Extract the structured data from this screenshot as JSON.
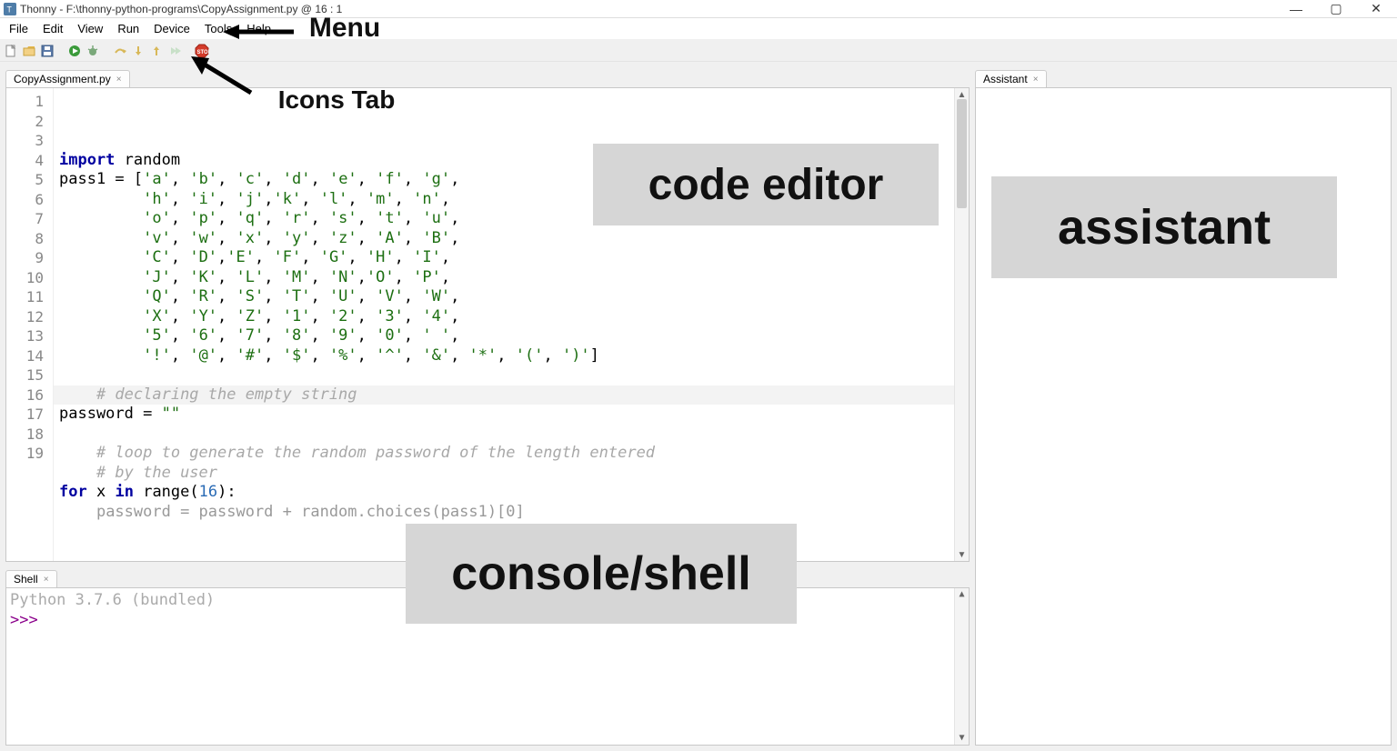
{
  "window": {
    "title": "Thonny  -  F:\\thonny-python-programs\\CopyAssignment.py  @  16 : 1",
    "buttons": {
      "min": "—",
      "max": "▢",
      "close": "✕"
    }
  },
  "menus": [
    "File",
    "Edit",
    "View",
    "Run",
    "Device",
    "Tools",
    "Help"
  ],
  "toolbar_icons": [
    "new-file-icon",
    "open-file-icon",
    "save-file-icon",
    "sep",
    "run-icon",
    "debug-icon",
    "sep",
    "step-over-icon",
    "step-into-icon",
    "step-out-icon",
    "resume-icon",
    "sep",
    "stop-icon"
  ],
  "editor": {
    "tab_label": "CopyAssignment.py",
    "line_count": 19,
    "current_line": 16,
    "code_lines": [
      {
        "n": 1,
        "html": "<span class='tok-kw'>import</span> <span class='tok-def'>random</span>"
      },
      {
        "n": 2,
        "html": "<span class='tok-def'>pass1</span> = [<span class='tok-str'>'a'</span>, <span class='tok-str'>'b'</span>, <span class='tok-str'>'c'</span>, <span class='tok-str'>'d'</span>, <span class='tok-str'>'e'</span>, <span class='tok-str'>'f'</span>, <span class='tok-str'>'g'</span>,"
      },
      {
        "n": 3,
        "html": "         <span class='tok-str'>'h'</span>, <span class='tok-str'>'i'</span>, <span class='tok-str'>'j'</span>,<span class='tok-str'>'k'</span>, <span class='tok-str'>'l'</span>, <span class='tok-str'>'m'</span>, <span class='tok-str'>'n'</span>,"
      },
      {
        "n": 4,
        "html": "         <span class='tok-str'>'o'</span>, <span class='tok-str'>'p'</span>, <span class='tok-str'>'q'</span>, <span class='tok-str'>'r'</span>, <span class='tok-str'>'s'</span>, <span class='tok-str'>'t'</span>, <span class='tok-str'>'u'</span>,"
      },
      {
        "n": 5,
        "html": "         <span class='tok-str'>'v'</span>, <span class='tok-str'>'w'</span>, <span class='tok-str'>'x'</span>, <span class='tok-str'>'y'</span>, <span class='tok-str'>'z'</span>, <span class='tok-str'>'A'</span>, <span class='tok-str'>'B'</span>,"
      },
      {
        "n": 6,
        "html": "         <span class='tok-str'>'C'</span>, <span class='tok-str'>'D'</span>,<span class='tok-str'>'E'</span>, <span class='tok-str'>'F'</span>, <span class='tok-str'>'G'</span>, <span class='tok-str'>'H'</span>, <span class='tok-str'>'I'</span>,"
      },
      {
        "n": 7,
        "html": "         <span class='tok-str'>'J'</span>, <span class='tok-str'>'K'</span>, <span class='tok-str'>'L'</span>, <span class='tok-str'>'M'</span>, <span class='tok-str'>'N'</span>,<span class='tok-str'>'O'</span>, <span class='tok-str'>'P'</span>,"
      },
      {
        "n": 8,
        "html": "         <span class='tok-str'>'Q'</span>, <span class='tok-str'>'R'</span>, <span class='tok-str'>'S'</span>, <span class='tok-str'>'T'</span>, <span class='tok-str'>'U'</span>, <span class='tok-str'>'V'</span>, <span class='tok-str'>'W'</span>,"
      },
      {
        "n": 9,
        "html": "         <span class='tok-str'>'X'</span>, <span class='tok-str'>'Y'</span>, <span class='tok-str'>'Z'</span>, <span class='tok-str'>'1'</span>, <span class='tok-str'>'2'</span>, <span class='tok-str'>'3'</span>, <span class='tok-str'>'4'</span>,"
      },
      {
        "n": 10,
        "html": "         <span class='tok-str'>'5'</span>, <span class='tok-str'>'6'</span>, <span class='tok-str'>'7'</span>, <span class='tok-str'>'8'</span>, <span class='tok-str'>'9'</span>, <span class='tok-str'>'0'</span>, <span class='tok-str'>' '</span>,"
      },
      {
        "n": 11,
        "html": "         <span class='tok-str'>'!'</span>, <span class='tok-str'>'@'</span>, <span class='tok-str'>'#'</span>, <span class='tok-str'>'$'</span>, <span class='tok-str'>'%'</span>, <span class='tok-str'>'^'</span>, <span class='tok-str'>'&amp;'</span>, <span class='tok-str'>'*'</span>, <span class='tok-str'>'('</span>, <span class='tok-str'>')'</span>]"
      },
      {
        "n": 12,
        "html": ""
      },
      {
        "n": 13,
        "html": "    <span class='tok-com'># declaring the empty string</span>"
      },
      {
        "n": 14,
        "html": "<span class='tok-def'>password</span> = <span class='tok-str'>\"\"</span>"
      },
      {
        "n": 15,
        "html": ""
      },
      {
        "n": 16,
        "html": "    <span class='tok-com'># loop to generate the random password of the length entered</span>"
      },
      {
        "n": 17,
        "html": "    <span class='tok-com'># by the user</span>"
      },
      {
        "n": 18,
        "html": "<span class='tok-kw'>for</span> <span class='tok-def'>x</span> <span class='tok-kw'>in</span> <span class='tok-def'>range</span>(<span class='tok-num'>16</span>):"
      },
      {
        "n": 19,
        "html": "    <span class='line-partial'>password = password + random.choices(pass1)[0]</span>"
      }
    ]
  },
  "shell": {
    "tab_label": "Shell",
    "info_line": "Python 3.7.6 (bundled)",
    "prompt": ">>>"
  },
  "assistant": {
    "tab_label": "Assistant"
  },
  "annotations": {
    "menu": "Menu",
    "icons": "Icons Tab",
    "editor": "code editor",
    "shell": "console/shell",
    "assistant": "assistant"
  }
}
